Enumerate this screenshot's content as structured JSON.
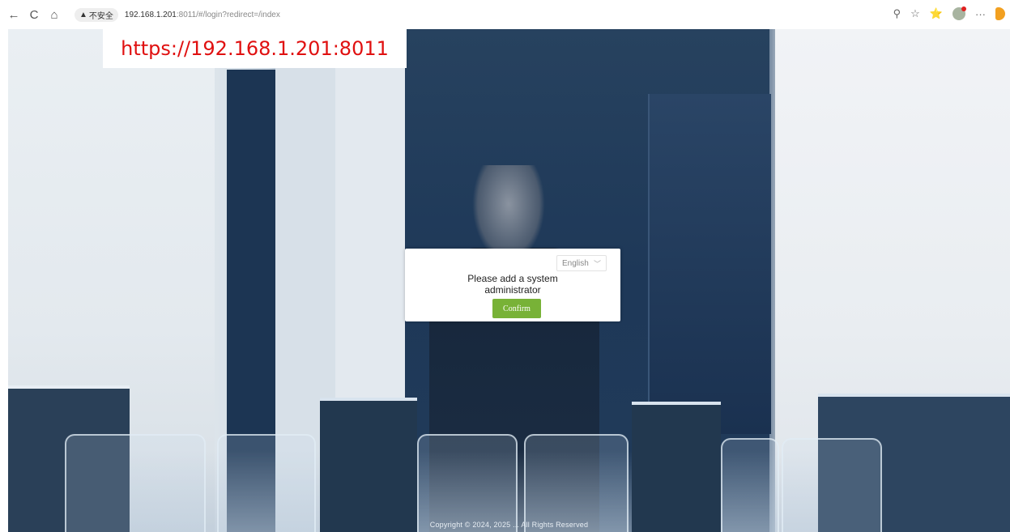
{
  "browser": {
    "nav": {
      "back_icon": "←",
      "reload_icon": "C",
      "home_icon": "⌂"
    },
    "security_label": "不安全",
    "url_host": "192.168.1.201",
    "url_rest": ":8011/#/login?redirect=/index",
    "tools": {
      "zoom_icon": "⚲",
      "favorite_icon": "☆",
      "favorites_list_icon": "⭐",
      "more_icon": "···"
    }
  },
  "overlay": {
    "url_label": "https://192.168.1.201:8011",
    "color": "#e01010"
  },
  "dialog": {
    "language": "English",
    "message": "Please add a system administrator",
    "confirm_label": "Confirm",
    "confirm_color": "#78b237"
  },
  "footer": {
    "copyright": "Copyright © 2024, 2025 ... All Rights Reserved"
  }
}
